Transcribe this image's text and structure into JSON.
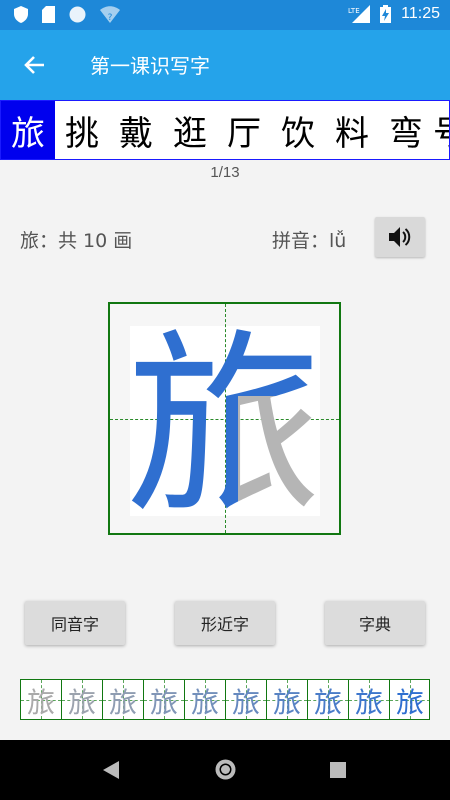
{
  "status_bar": {
    "time": "11:25",
    "network": "LTE",
    "left_icons": [
      "shield-icon",
      "sd-card-icon",
      "circle-icon",
      "wifi-unknown-icon"
    ],
    "right_icons": [
      "lte-signal-icon",
      "battery-charging-icon"
    ]
  },
  "app_bar": {
    "title": "第一课识写字",
    "back_icon": "arrow-left-icon"
  },
  "char_strip": {
    "items": [
      "旅",
      "挑",
      "戴",
      "逛",
      "厅",
      "饮",
      "料",
      "弯",
      "号"
    ],
    "active_index": 0
  },
  "counter": "1/13",
  "info": {
    "char_strokes": "旅：共 10 画",
    "pinyin": "拼音：lǚ",
    "sound_icon": "speaker-icon"
  },
  "practice": {
    "character": "旅",
    "colors": {
      "written": "#2f6fd0",
      "remaining": "#b5b5b5",
      "grid": "#117711"
    }
  },
  "buttons": {
    "homophone": "同音字",
    "similar": "形近字",
    "dictionary": "字典"
  },
  "stroke_order": {
    "character": "旅",
    "cells": 10
  },
  "nav_bar": {
    "icons": [
      "back-triangle-icon",
      "home-circle-icon",
      "recents-square-icon"
    ]
  }
}
